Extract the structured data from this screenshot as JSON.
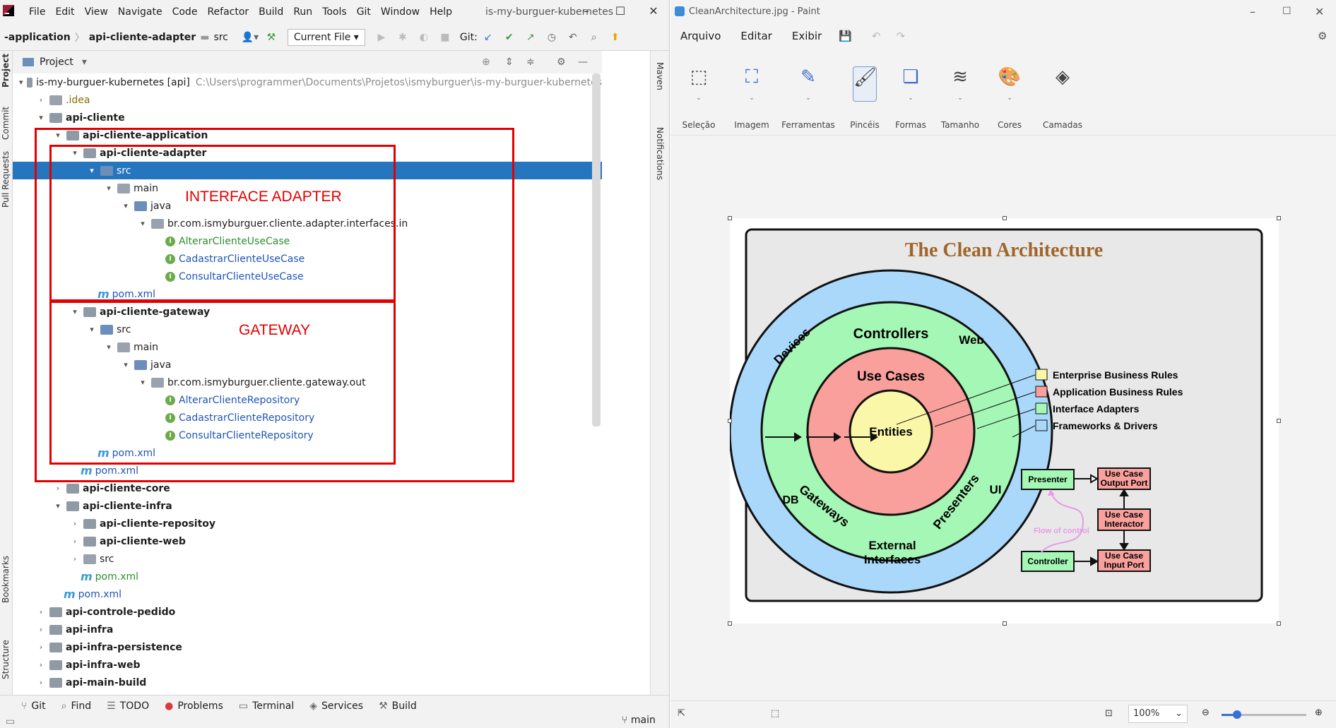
{
  "ide": {
    "menu": [
      "File",
      "Edit",
      "View",
      "Navigate",
      "Code",
      "Refactor",
      "Build",
      "Run",
      "Tools",
      "Git",
      "Window",
      "Help"
    ],
    "title": "is-my-burguer-kubernetes",
    "breadcrumbs": [
      "-application",
      "api-cliente-adapter",
      "src"
    ],
    "run_config": "Current File",
    "git_label": "Git:",
    "project_label": "Project",
    "left_tabs": [
      "Project",
      "Commit",
      "Pull Requests",
      "Bookmarks",
      "Structure"
    ],
    "right_tabs": [
      "Maven",
      "Notifications"
    ],
    "tree": [
      {
        "label": "is-my-burguer-kubernetes [api]",
        "path": "C:\\Users\\programmer\\Documents\\Projetos\\ismyburguer\\is-my-burguer-kubernetes"
      },
      {
        "label": ".idea"
      },
      {
        "label": "api-cliente"
      },
      {
        "label": "api-cliente-application"
      },
      {
        "label": "api-cliente-adapter"
      },
      {
        "label": "src"
      },
      {
        "label": "main"
      },
      {
        "label": "java"
      },
      {
        "label": "br.com.ismyburguer.cliente.adapter.interfaces.in"
      },
      {
        "label": "AlterarClienteUseCase"
      },
      {
        "label": "CadastrarClienteUseCase"
      },
      {
        "label": "ConsultarClienteUseCase"
      },
      {
        "label": "pom.xml"
      },
      {
        "label": "api-cliente-gateway"
      },
      {
        "label": "src"
      },
      {
        "label": "main"
      },
      {
        "label": "java"
      },
      {
        "label": "br.com.ismyburguer.cliente.gateway.out"
      },
      {
        "label": "AlterarClienteRepository"
      },
      {
        "label": "CadastrarClienteRepository"
      },
      {
        "label": "ConsultarClienteRepository"
      },
      {
        "label": "pom.xml"
      },
      {
        "label": "pom.xml"
      },
      {
        "label": "api-cliente-core"
      },
      {
        "label": "api-cliente-infra"
      },
      {
        "label": "api-cliente-repositoy"
      },
      {
        "label": "api-cliente-web"
      },
      {
        "label": "src"
      },
      {
        "label": "pom.xml"
      },
      {
        "label": "pom.xml"
      },
      {
        "label": "api-controle-pedido"
      },
      {
        "label": "api-infra"
      },
      {
        "label": "api-infra-persistence"
      },
      {
        "label": "api-infra-web"
      },
      {
        "label": "api-main-build"
      }
    ],
    "annotations": {
      "interface_adapter": "INTERFACE ADAPTER",
      "gateway": "GATEWAY"
    },
    "bottom_tools": [
      "Git",
      "Find",
      "TODO",
      "Problems",
      "Terminal",
      "Services",
      "Build"
    ],
    "branch": "main"
  },
  "paint": {
    "title": "CleanArchitecture.jpg - Paint",
    "menu": [
      "Arquivo",
      "Editar",
      "Exibir"
    ],
    "tools": [
      "Seleção",
      "Imagem",
      "Ferramentas",
      "Pincéis",
      "Formas",
      "Tamanho",
      "Cores",
      "Camadas"
    ],
    "zoom": "100%",
    "diagram": {
      "title": "The Clean Architecture",
      "rings": {
        "outer": "Devices",
        "web": "Web",
        "ui": "UI",
        "db": "DB",
        "external": "External Interfaces",
        "controllers": "Controllers",
        "gateways": "Gateways",
        "presenters": "Presenters",
        "usecases": "Use Cases",
        "entities": "Entities"
      },
      "legend": [
        "Enterprise Business Rules",
        "Application Business Rules",
        "Interface Adapters",
        "Frameworks & Drivers"
      ],
      "flow": {
        "presenter": "Presenter",
        "output_port": "Use Case Output Port",
        "interactor": "Use Case Interactor",
        "input_port": "Use Case Input Port",
        "controller": "Controller",
        "flow_label": "Flow of control"
      }
    },
    "colors": {
      "entities": "#fbf7a8",
      "usecases": "#f9a09c",
      "adapters": "#a4f7b4",
      "frameworks": "#aad8fb",
      "title": "#a0652a",
      "flow": "#e89be8"
    }
  }
}
